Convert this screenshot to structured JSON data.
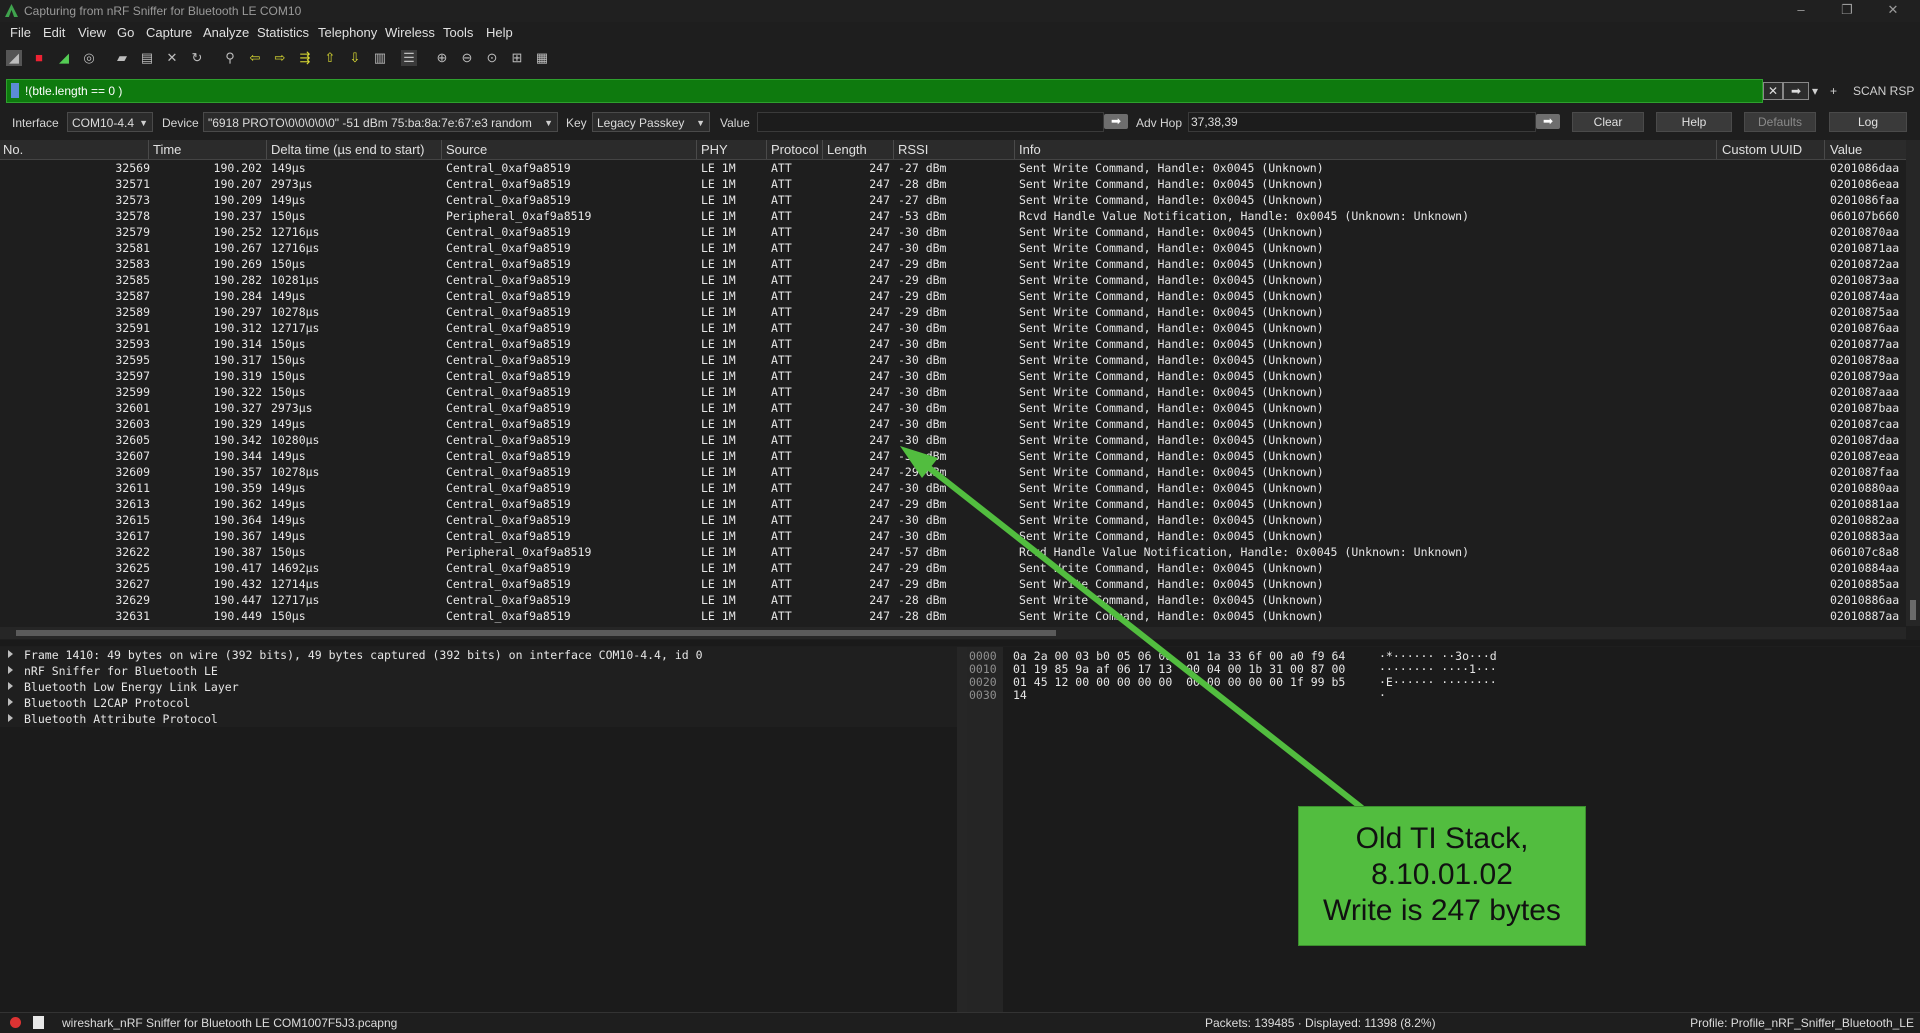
{
  "window": {
    "title": "Capturing from nRF Sniffer for Bluetooth LE COM10",
    "controls": [
      "–",
      "❐",
      "✕"
    ]
  },
  "menu": [
    "File",
    "Edit",
    "View",
    "Go",
    "Capture",
    "Analyze",
    "Statistics",
    "Telephony",
    "Wireless",
    "Tools",
    "Help"
  ],
  "toolbar_icons": [
    "shark-fin-start-icon",
    "stop-icon",
    "restart-icon",
    "options-icon",
    "open-folder-icon",
    "save-icon",
    "close-file-icon",
    "reload-icon",
    "find-icon",
    "back-icon",
    "forward-icon",
    "goto-icon",
    "first-icon",
    "last-icon",
    "autoscroll-icon",
    "colorize-icon",
    "zoom-in-icon",
    "zoom-out-icon",
    "zoom-reset-icon",
    "resize-columns-icon"
  ],
  "filter": {
    "text": "!(btle.length == 0 )",
    "plus": "+",
    "scan_rsp": "SCAN RSP"
  },
  "device_bar": {
    "interface_label": "Interface",
    "interface_value": "COM10-4.4",
    "device_label": "Device",
    "device_value": "\"6918 PROTO\\0\\0\\0\\0\\0\"  -51 dBm  75:ba:8a:7e:67:e3  random",
    "key_label": "Key",
    "key_value": "Legacy Passkey",
    "value_label": "Value",
    "adv_hop_label": "Adv Hop",
    "adv_hop_value": "37,38,39",
    "buttons": {
      "clear": "Clear",
      "help": "Help",
      "defaults": "Defaults",
      "log": "Log"
    }
  },
  "columns": [
    "No.",
    "Time",
    "Delta time (µs end to start)",
    "Source",
    "PHY",
    "Protocol",
    "Length",
    "RSSI",
    "Info",
    "Custom UUID",
    "Value"
  ],
  "packets": [
    {
      "no": "32569",
      "time": "190.202",
      "delta": "149µs",
      "source": "Central_0xaf9a8519",
      "phy": "LE 1M",
      "proto": "ATT",
      "len": "247",
      "rssi": "-27 dBm",
      "info": "Sent Write Command, Handle: 0x0045 (Unknown)",
      "uuid": "",
      "value": "0201086daa"
    },
    {
      "no": "32571",
      "time": "190.207",
      "delta": "2973µs",
      "source": "Central_0xaf9a8519",
      "phy": "LE 1M",
      "proto": "ATT",
      "len": "247",
      "rssi": "-28 dBm",
      "info": "Sent Write Command, Handle: 0x0045 (Unknown)",
      "uuid": "",
      "value": "0201086eaa"
    },
    {
      "no": "32573",
      "time": "190.209",
      "delta": "149µs",
      "source": "Central_0xaf9a8519",
      "phy": "LE 1M",
      "proto": "ATT",
      "len": "247",
      "rssi": "-27 dBm",
      "info": "Sent Write Command, Handle: 0x0045 (Unknown)",
      "uuid": "",
      "value": "0201086faa"
    },
    {
      "no": "32578",
      "time": "190.237",
      "delta": "150µs",
      "source": "Peripheral_0xaf9a8519",
      "phy": "LE 1M",
      "proto": "ATT",
      "len": "247",
      "rssi": "-53 dBm",
      "info": "Rcvd Handle Value Notification, Handle: 0x0045 (Unknown: Unknown)",
      "uuid": "",
      "value": "060107b660"
    },
    {
      "no": "32579",
      "time": "190.252",
      "delta": "12716µs",
      "source": "Central_0xaf9a8519",
      "phy": "LE 1M",
      "proto": "ATT",
      "len": "247",
      "rssi": "-30 dBm",
      "info": "Sent Write Command, Handle: 0x0045 (Unknown)",
      "uuid": "",
      "value": "02010870aa"
    },
    {
      "no": "32581",
      "time": "190.267",
      "delta": "12716µs",
      "source": "Central_0xaf9a8519",
      "phy": "LE 1M",
      "proto": "ATT",
      "len": "247",
      "rssi": "-30 dBm",
      "info": "Sent Write Command, Handle: 0x0045 (Unknown)",
      "uuid": "",
      "value": "02010871aa"
    },
    {
      "no": "32583",
      "time": "190.269",
      "delta": "150µs",
      "source": "Central_0xaf9a8519",
      "phy": "LE 1M",
      "proto": "ATT",
      "len": "247",
      "rssi": "-29 dBm",
      "info": "Sent Write Command, Handle: 0x0045 (Unknown)",
      "uuid": "",
      "value": "02010872aa"
    },
    {
      "no": "32585",
      "time": "190.282",
      "delta": "10281µs",
      "source": "Central_0xaf9a8519",
      "phy": "LE 1M",
      "proto": "ATT",
      "len": "247",
      "rssi": "-29 dBm",
      "info": "Sent Write Command, Handle: 0x0045 (Unknown)",
      "uuid": "",
      "value": "02010873aa"
    },
    {
      "no": "32587",
      "time": "190.284",
      "delta": "149µs",
      "source": "Central_0xaf9a8519",
      "phy": "LE 1M",
      "proto": "ATT",
      "len": "247",
      "rssi": "-29 dBm",
      "info": "Sent Write Command, Handle: 0x0045 (Unknown)",
      "uuid": "",
      "value": "02010874aa"
    },
    {
      "no": "32589",
      "time": "190.297",
      "delta": "10278µs",
      "source": "Central_0xaf9a8519",
      "phy": "LE 1M",
      "proto": "ATT",
      "len": "247",
      "rssi": "-29 dBm",
      "info": "Sent Write Command, Handle: 0x0045 (Unknown)",
      "uuid": "",
      "value": "02010875aa"
    },
    {
      "no": "32591",
      "time": "190.312",
      "delta": "12717µs",
      "source": "Central_0xaf9a8519",
      "phy": "LE 1M",
      "proto": "ATT",
      "len": "247",
      "rssi": "-30 dBm",
      "info": "Sent Write Command, Handle: 0x0045 (Unknown)",
      "uuid": "",
      "value": "02010876aa"
    },
    {
      "no": "32593",
      "time": "190.314",
      "delta": "150µs",
      "source": "Central_0xaf9a8519",
      "phy": "LE 1M",
      "proto": "ATT",
      "len": "247",
      "rssi": "-30 dBm",
      "info": "Sent Write Command, Handle: 0x0045 (Unknown)",
      "uuid": "",
      "value": "02010877aa"
    },
    {
      "no": "32595",
      "time": "190.317",
      "delta": "150µs",
      "source": "Central_0xaf9a8519",
      "phy": "LE 1M",
      "proto": "ATT",
      "len": "247",
      "rssi": "-30 dBm",
      "info": "Sent Write Command, Handle: 0x0045 (Unknown)",
      "uuid": "",
      "value": "02010878aa"
    },
    {
      "no": "32597",
      "time": "190.319",
      "delta": "150µs",
      "source": "Central_0xaf9a8519",
      "phy": "LE 1M",
      "proto": "ATT",
      "len": "247",
      "rssi": "-30 dBm",
      "info": "Sent Write Command, Handle: 0x0045 (Unknown)",
      "uuid": "",
      "value": "02010879aa"
    },
    {
      "no": "32599",
      "time": "190.322",
      "delta": "150µs",
      "source": "Central_0xaf9a8519",
      "phy": "LE 1M",
      "proto": "ATT",
      "len": "247",
      "rssi": "-30 dBm",
      "info": "Sent Write Command, Handle: 0x0045 (Unknown)",
      "uuid": "",
      "value": "0201087aaa"
    },
    {
      "no": "32601",
      "time": "190.327",
      "delta": "2973µs",
      "source": "Central_0xaf9a8519",
      "phy": "LE 1M",
      "proto": "ATT",
      "len": "247",
      "rssi": "-30 dBm",
      "info": "Sent Write Command, Handle: 0x0045 (Unknown)",
      "uuid": "",
      "value": "0201087baa"
    },
    {
      "no": "32603",
      "time": "190.329",
      "delta": "149µs",
      "source": "Central_0xaf9a8519",
      "phy": "LE 1M",
      "proto": "ATT",
      "len": "247",
      "rssi": "-30 dBm",
      "info": "Sent Write Command, Handle: 0x0045 (Unknown)",
      "uuid": "",
      "value": "0201087caa"
    },
    {
      "no": "32605",
      "time": "190.342",
      "delta": "10280µs",
      "source": "Central_0xaf9a8519",
      "phy": "LE 1M",
      "proto": "ATT",
      "len": "247",
      "rssi": "-30 dBm",
      "info": "Sent Write Command, Handle: 0x0045 (Unknown)",
      "uuid": "",
      "value": "0201087daa"
    },
    {
      "no": "32607",
      "time": "190.344",
      "delta": "149µs",
      "source": "Central_0xaf9a8519",
      "phy": "LE 1M",
      "proto": "ATT",
      "len": "247",
      "rssi": "-30 dBm",
      "info": "Sent Write Command, Handle: 0x0045 (Unknown)",
      "uuid": "",
      "value": "0201087eaa"
    },
    {
      "no": "32609",
      "time": "190.357",
      "delta": "10278µs",
      "source": "Central_0xaf9a8519",
      "phy": "LE 1M",
      "proto": "ATT",
      "len": "247",
      "rssi": "-29 dBm",
      "info": "Sent Write Command, Handle: 0x0045 (Unknown)",
      "uuid": "",
      "value": "0201087faa"
    },
    {
      "no": "32611",
      "time": "190.359",
      "delta": "149µs",
      "source": "Central_0xaf9a8519",
      "phy": "LE 1M",
      "proto": "ATT",
      "len": "247",
      "rssi": "-30 dBm",
      "info": "Sent Write Command, Handle: 0x0045 (Unknown)",
      "uuid": "",
      "value": "02010880aa"
    },
    {
      "no": "32613",
      "time": "190.362",
      "delta": "149µs",
      "source": "Central_0xaf9a8519",
      "phy": "LE 1M",
      "proto": "ATT",
      "len": "247",
      "rssi": "-29 dBm",
      "info": "Sent Write Command, Handle: 0x0045 (Unknown)",
      "uuid": "",
      "value": "02010881aa"
    },
    {
      "no": "32615",
      "time": "190.364",
      "delta": "149µs",
      "source": "Central_0xaf9a8519",
      "phy": "LE 1M",
      "proto": "ATT",
      "len": "247",
      "rssi": "-30 dBm",
      "info": "Sent Write Command, Handle: 0x0045 (Unknown)",
      "uuid": "",
      "value": "02010882aa"
    },
    {
      "no": "32617",
      "time": "190.367",
      "delta": "149µs",
      "source": "Central_0xaf9a8519",
      "phy": "LE 1M",
      "proto": "ATT",
      "len": "247",
      "rssi": "-30 dBm",
      "info": "Sent Write Command, Handle: 0x0045 (Unknown)",
      "uuid": "",
      "value": "02010883aa"
    },
    {
      "no": "32622",
      "time": "190.387",
      "delta": "150µs",
      "source": "Peripheral_0xaf9a8519",
      "phy": "LE 1M",
      "proto": "ATT",
      "len": "247",
      "rssi": "-57 dBm",
      "info": "Rcvd Handle Value Notification, Handle: 0x0045 (Unknown: Unknown)",
      "uuid": "",
      "value": "060107c8a8"
    },
    {
      "no": "32625",
      "time": "190.417",
      "delta": "14692µs",
      "source": "Central_0xaf9a8519",
      "phy": "LE 1M",
      "proto": "ATT",
      "len": "247",
      "rssi": "-29 dBm",
      "info": "Sent Write Command, Handle: 0x0045 (Unknown)",
      "uuid": "",
      "value": "02010884aa"
    },
    {
      "no": "32627",
      "time": "190.432",
      "delta": "12714µs",
      "source": "Central_0xaf9a8519",
      "phy": "LE 1M",
      "proto": "ATT",
      "len": "247",
      "rssi": "-29 dBm",
      "info": "Sent Write Command, Handle: 0x0045 (Unknown)",
      "uuid": "",
      "value": "02010885aa"
    },
    {
      "no": "32629",
      "time": "190.447",
      "delta": "12717µs",
      "source": "Central_0xaf9a8519",
      "phy": "LE 1M",
      "proto": "ATT",
      "len": "247",
      "rssi": "-28 dBm",
      "info": "Sent Write Command, Handle: 0x0045 (Unknown)",
      "uuid": "",
      "value": "02010886aa"
    },
    {
      "no": "32631",
      "time": "190.449",
      "delta": "150µs",
      "source": "Central_0xaf9a8519",
      "phy": "LE 1M",
      "proto": "ATT",
      "len": "247",
      "rssi": "-28 dBm",
      "info": "Sent Write Command, Handle: 0x0045 (Unknown)",
      "uuid": "",
      "value": "02010887aa"
    }
  ],
  "details": [
    "Frame 1410: 49 bytes on wire (392 bits), 49 bytes captured (392 bits) on interface COM10-4.4, id 0",
    "nRF Sniffer for Bluetooth LE",
    "Bluetooth Low Energy Link Layer",
    "Bluetooth L2CAP Protocol",
    "Bluetooth Attribute Protocol"
  ],
  "bytes": [
    {
      "off": "0000",
      "hex": "0a 2a 00 03 b0 05 06 0a  01 1a 33 6f 00 a0 f9 64",
      "ascii": "·*······ ··3o···d"
    },
    {
      "off": "0010",
      "hex": "01 19 85 9a af 06 17 13  00 04 00 1b 31 00 87 00",
      "ascii": "········ ····1···"
    },
    {
      "off": "0020",
      "hex": "01 45 12 00 00 00 00 00  00 00 00 00 00 1f 99 b5",
      "ascii": "·E······ ········"
    },
    {
      "off": "0030",
      "hex": "14",
      "ascii": "·"
    }
  ],
  "callout": {
    "lines": [
      "Old TI Stack,",
      "8.10.01.02",
      "Write is 247 bytes"
    ],
    "color": "#52bd3f"
  },
  "status": {
    "file": "wireshark_nRF Sniffer for Bluetooth LE COM1007F5J3.pcapng",
    "packets": "Packets: 139485 · Displayed: 11398 (8.2%)",
    "profile": "Profile: Profile_nRF_Sniffer_Bluetooth_LE"
  },
  "colors": {
    "filter_bg": "#0e7a0e",
    "background": "#1e1e1e"
  }
}
